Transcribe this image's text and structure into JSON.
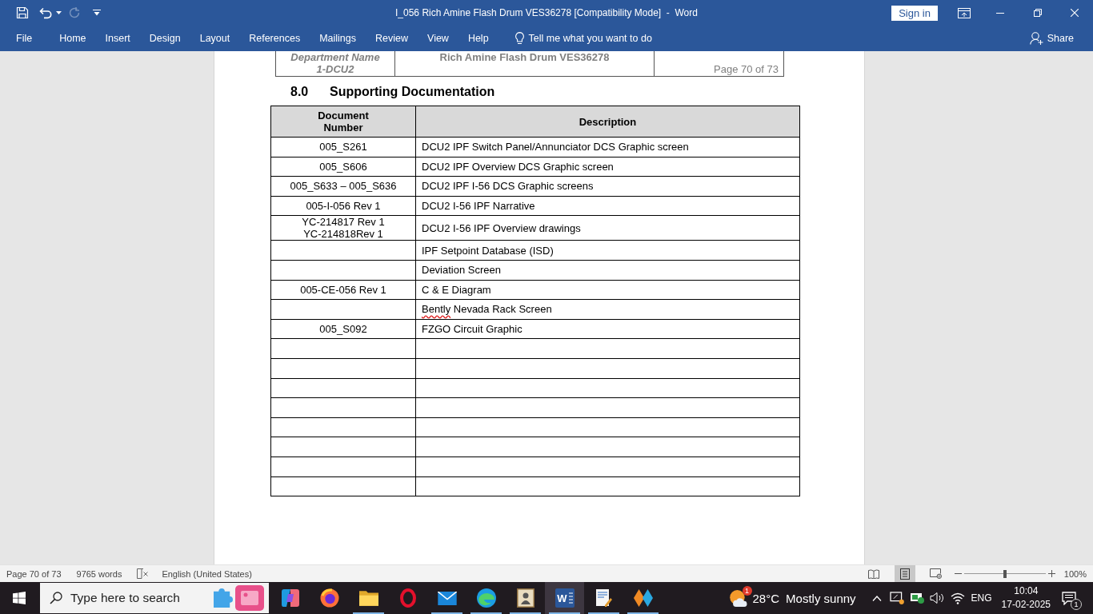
{
  "window": {
    "title": "I_056 Rich Amine Flash Drum VES36278 [Compatibility Mode]  -  Word",
    "sign_in": "Sign in"
  },
  "quick_access": [
    {
      "kind": "save",
      "disabled": false
    },
    {
      "kind": "undo",
      "disabled": false
    },
    {
      "kind": "redo",
      "disabled": true
    },
    {
      "kind": "customize",
      "disabled": false
    }
  ],
  "ribbon": {
    "tabs": [
      {
        "label": "File",
        "selected": false
      },
      {
        "label": "Home",
        "selected": false
      },
      {
        "label": "Insert",
        "selected": false
      },
      {
        "label": "Design",
        "selected": false
      },
      {
        "label": "Layout",
        "selected": false
      },
      {
        "label": "References",
        "selected": false
      },
      {
        "label": "Mailings",
        "selected": false
      },
      {
        "label": "Review",
        "selected": false
      },
      {
        "label": "View",
        "selected": false
      },
      {
        "label": "Help",
        "selected": false
      }
    ],
    "tell_me": "Tell me what you want to do",
    "share": "Share"
  },
  "document": {
    "header": {
      "department_label": "Department Name",
      "department": "1-DCU2",
      "title": "Rich Amine Flash Drum VES36278",
      "page": "Page 70 of 73"
    },
    "section": {
      "number": "8.0",
      "title": "Supporting Documentation"
    },
    "table": {
      "columns": [
        "Document\nNumber",
        "Description"
      ],
      "rows": [
        {
          "number": "005_S261",
          "description": "DCU2 IPF Switch Panel/Annunciator DCS Graphic screen"
        },
        {
          "number": "005_S606",
          "description": "DCU2 IPF Overview DCS Graphic screen"
        },
        {
          "number": "005_S633 – 005_S636",
          "description": "DCU2 IPF I-56 DCS Graphic screens"
        },
        {
          "number": "005-I-056 Rev 1",
          "description": "DCU2 I-56 IPF Narrative"
        },
        {
          "number": "YC-214817 Rev 1\nYC-214818Rev 1",
          "description": "DCU2 I-56 IPF Overview drawings"
        },
        {
          "description": "IPF Setpoint Database (ISD)"
        },
        {
          "description": "Deviation Screen"
        },
        {
          "number": "005-CE-056 Rev 1",
          "description": "C & E Diagram"
        },
        {
          "description_parts": [
            {
              "text": "Bently",
              "misspelled": true
            },
            {
              "text": "Nevada Rack Screen",
              "misspelled": false
            }
          ]
        },
        {
          "number": "005_S092",
          "description": "FZGO Circuit Graphic"
        },
        {},
        {},
        {},
        {},
        {},
        {},
        {},
        {}
      ]
    }
  },
  "status_bar": {
    "page": "Page 70 of 73",
    "words": "9765 words",
    "language": "English (United States)",
    "views": [
      {
        "kind": "read",
        "selected": false
      },
      {
        "kind": "print",
        "selected": true
      },
      {
        "kind": "web",
        "selected": false
      }
    ],
    "zoom": {
      "level": 0.5,
      "reading": "100%"
    }
  },
  "taskbar": {
    "search": {
      "placeholder": "Type here to search"
    },
    "apps": [
      {
        "kind": "copilot",
        "running": false,
        "selected": false
      },
      {
        "kind": "firefox",
        "running": false,
        "selected": false
      },
      {
        "kind": "explorer",
        "running": true,
        "selected": false
      },
      {
        "kind": "opera",
        "running": false,
        "selected": false
      },
      {
        "kind": "mail",
        "running": true,
        "selected": false
      },
      {
        "kind": "edge",
        "running": true,
        "selected": false
      },
      {
        "kind": "portrait",
        "running": true,
        "selected": false
      },
      {
        "kind": "word",
        "running": true,
        "selected": true,
        "glyph": "W"
      },
      {
        "kind": "editor",
        "running": true,
        "selected": false
      },
      {
        "kind": "diamonds",
        "running": true,
        "selected": false
      }
    ],
    "weather": {
      "temperature": "28°C",
      "condition": "Mostly sunny",
      "badge": "1"
    },
    "tray": {
      "language": "ENG",
      "time": "10:04",
      "date": "17-02-2025",
      "notifications": "1"
    }
  }
}
